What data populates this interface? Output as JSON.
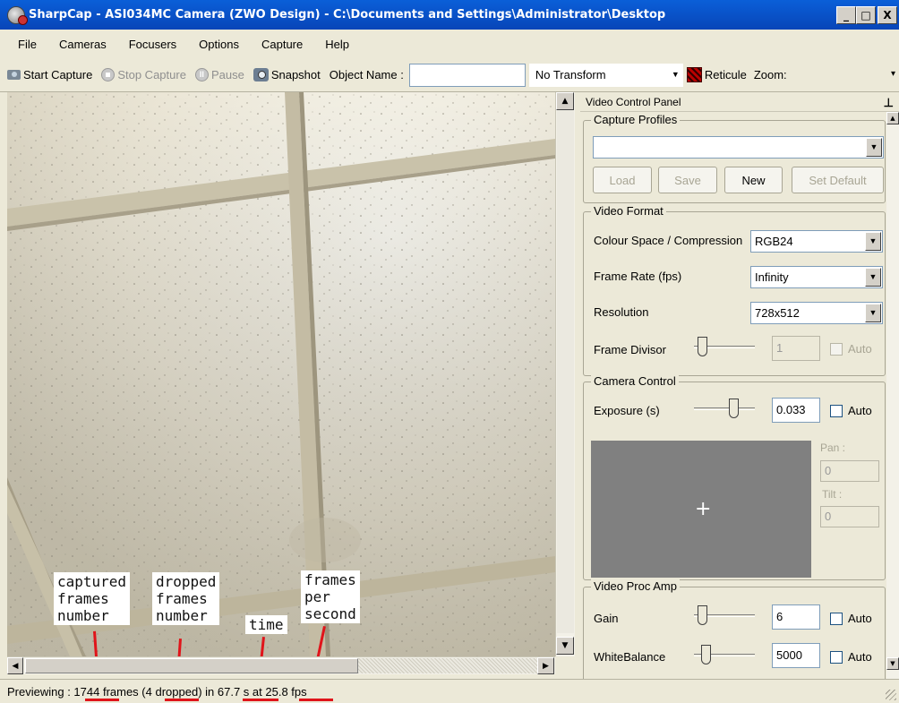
{
  "window": {
    "title": "SharpCap - ASI034MC Camera (ZWO Design) - C:\\Documents and Settings\\Administrator\\Desktop",
    "min": "_",
    "max": "□",
    "close": "X"
  },
  "menu": [
    "File",
    "Cameras",
    "Focusers",
    "Options",
    "Capture",
    "Help"
  ],
  "toolbar": {
    "start_capture": "Start Capture",
    "stop_capture": "Stop Capture",
    "pause": "Pause",
    "snapshot": "Snapshot",
    "object_name_label": "Object Name :",
    "object_name_value": "",
    "transform": "No Transform",
    "reticule": "Reticule",
    "zoom": "Zoom:"
  },
  "annotations": {
    "captured": "captured\nframes\nnumber",
    "dropped": "dropped\nframes\nnumber",
    "time": "time",
    "fps": "frames\nper\nsecond"
  },
  "status": {
    "prefix": "Previewing : ",
    "frames": "1744",
    "frames_suffix": " frames (",
    "dropped": "4",
    "dropped_suffix": " dropped) in ",
    "time": "67.7",
    "time_suffix": " s at ",
    "fps": "25.8",
    "fps_suffix": " fps"
  },
  "panel": {
    "title": "Video Control Panel",
    "capture_profiles": {
      "title": "Capture Profiles",
      "selected": "",
      "load": "Load",
      "save": "Save",
      "new": "New",
      "set_default": "Set Default"
    },
    "video_format": {
      "title": "Video Format",
      "colour_space_label": "Colour Space / Compression",
      "colour_space_value": "RGB24",
      "frame_rate_label": "Frame Rate (fps)",
      "frame_rate_value": "Infinity",
      "resolution_label": "Resolution",
      "resolution_value": "728x512",
      "frame_divisor_label": "Frame Divisor",
      "frame_divisor_value": "1",
      "auto": "Auto"
    },
    "camera_control": {
      "title": "Camera Control",
      "exposure_label": "Exposure (s)",
      "exposure_value": "0.033",
      "auto": "Auto",
      "pan_label": "Pan :",
      "pan_value": "0",
      "tilt_label": "Tilt :",
      "tilt_value": "0",
      "cross": "+"
    },
    "proc_amp": {
      "title": "Video Proc Amp",
      "gain_label": "Gain",
      "gain_value": "6",
      "wb_label": "WhiteBalance",
      "wb_value": "5000",
      "auto": "Auto"
    }
  },
  "colors": {
    "titlebar": "#0a5fd8",
    "annotation_red": "#e0141a",
    "chrome": "#ece9d8"
  },
  "icons": {
    "app": "sharpcap-camera-icon",
    "start": "camera-icon",
    "stop": "stop-icon",
    "pause": "pause-icon",
    "snapshot": "snapshot-icon",
    "reticule": "reticule-icon",
    "pin": "pin-icon"
  }
}
